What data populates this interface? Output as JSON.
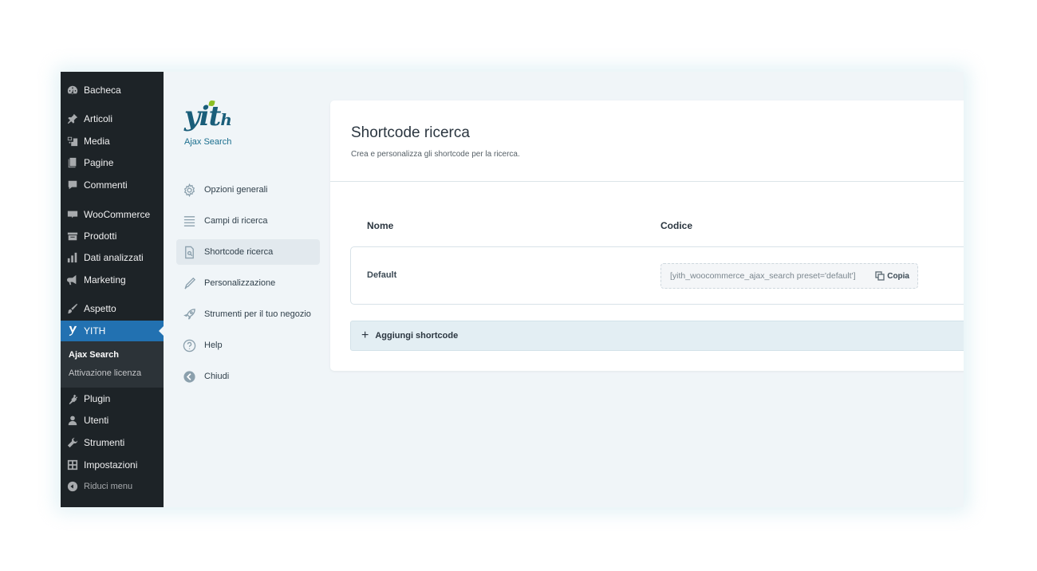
{
  "wp_menu": {
    "items": [
      {
        "label": "Bacheca",
        "icon": "dashboard-icon"
      },
      {
        "label": "Articoli",
        "icon": "pin-icon"
      },
      {
        "label": "Media",
        "icon": "media-icon"
      },
      {
        "label": "Pagine",
        "icon": "pages-icon"
      },
      {
        "label": "Commenti",
        "icon": "comments-icon"
      },
      {
        "label": "WooCommerce",
        "icon": "woo-icon"
      },
      {
        "label": "Prodotti",
        "icon": "products-icon"
      },
      {
        "label": "Dati analizzati",
        "icon": "analytics-icon"
      },
      {
        "label": "Marketing",
        "icon": "megaphone-icon"
      },
      {
        "label": "Aspetto",
        "icon": "brush-icon"
      },
      {
        "label": "YITH",
        "icon": "yith-icon"
      },
      {
        "label": "Plugin",
        "icon": "plugin-icon"
      },
      {
        "label": "Utenti",
        "icon": "user-icon"
      },
      {
        "label": "Strumenti",
        "icon": "wrench-icon"
      },
      {
        "label": "Impostazioni",
        "icon": "settings-icon"
      },
      {
        "label": "Riduci menu",
        "icon": "collapse-icon"
      }
    ],
    "submenu": [
      "Ajax Search",
      "Attivazione licenza"
    ]
  },
  "plugin": {
    "logo_text": "yit",
    "logo_suffix": "h",
    "name": "Ajax Search"
  },
  "panel_nav": [
    {
      "label": "Opzioni generali",
      "icon": "gear-icon"
    },
    {
      "label": "Campi di ricerca",
      "icon": "list-icon"
    },
    {
      "label": "Shortcode ricerca",
      "icon": "document-search-icon"
    },
    {
      "label": "Personalizzazione",
      "icon": "pencil-icon"
    },
    {
      "label": "Strumenti per il tuo negozio",
      "icon": "rocket-icon"
    },
    {
      "label": "Help",
      "icon": "help-icon"
    },
    {
      "label": "Chiudi",
      "icon": "back-arrow-icon"
    }
  ],
  "main": {
    "title": "Shortcode ricerca",
    "description": "Crea e personalizza gli shortcode per la ricerca.",
    "columns": [
      "Nome",
      "Codice"
    ],
    "rows": [
      {
        "name": "Default",
        "code": "[yith_woocommerce_ajax_search preset='default']",
        "copy_label": "Copia"
      }
    ],
    "add_label": "Aggiungi shortcode"
  },
  "colors": {
    "wp_sidebar": "#1d2327",
    "wp_active": "#2271b1",
    "panel_bg": "#f0f5f8",
    "accent": "#1a5e7a"
  }
}
